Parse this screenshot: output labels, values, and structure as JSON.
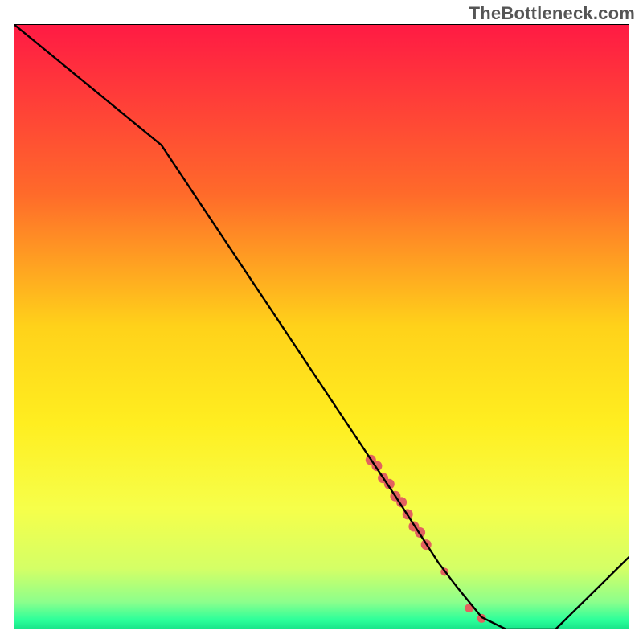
{
  "watermark": "TheBottleneck.com",
  "colors": {
    "gradient_stops": [
      {
        "offset": 0.0,
        "color": "#ff1a44"
      },
      {
        "offset": 0.28,
        "color": "#ff6a2a"
      },
      {
        "offset": 0.5,
        "color": "#ffd21a"
      },
      {
        "offset": 0.66,
        "color": "#ffee20"
      },
      {
        "offset": 0.8,
        "color": "#f6ff4a"
      },
      {
        "offset": 0.9,
        "color": "#d4ff66"
      },
      {
        "offset": 0.955,
        "color": "#8cff8c"
      },
      {
        "offset": 0.985,
        "color": "#2bff9a"
      },
      {
        "offset": 1.0,
        "color": "#17e389"
      }
    ],
    "curve": "#000000",
    "marker": "#e2625f",
    "border": "#000000"
  },
  "chart_data": {
    "type": "line",
    "title": "",
    "xlabel": "",
    "ylabel": "",
    "xlim": [
      0,
      100
    ],
    "ylim": [
      0,
      100
    ],
    "series": [
      {
        "name": "bottleneck-curve",
        "x": [
          0,
          24,
          62,
          69,
          72,
          76,
          80,
          88,
          100
        ],
        "y": [
          100,
          80,
          22,
          11,
          7,
          2,
          0,
          0,
          12
        ]
      }
    ],
    "markers": {
      "name": "highlighted-range",
      "points": [
        {
          "x": 58,
          "y": 28,
          "r": 6.5
        },
        {
          "x": 59,
          "y": 27,
          "r": 6.5
        },
        {
          "x": 60,
          "y": 25,
          "r": 6.5
        },
        {
          "x": 61,
          "y": 24,
          "r": 6.5
        },
        {
          "x": 62,
          "y": 22,
          "r": 6.5
        },
        {
          "x": 63,
          "y": 21,
          "r": 6.5
        },
        {
          "x": 64,
          "y": 19,
          "r": 6.5
        },
        {
          "x": 65,
          "y": 17,
          "r": 6.5
        },
        {
          "x": 66,
          "y": 16,
          "r": 6.5
        },
        {
          "x": 67,
          "y": 14,
          "r": 6.5
        },
        {
          "x": 70,
          "y": 9.5,
          "r": 5
        },
        {
          "x": 74,
          "y": 3.5,
          "r": 5.5
        },
        {
          "x": 76,
          "y": 1.8,
          "r": 5.5
        }
      ]
    }
  }
}
